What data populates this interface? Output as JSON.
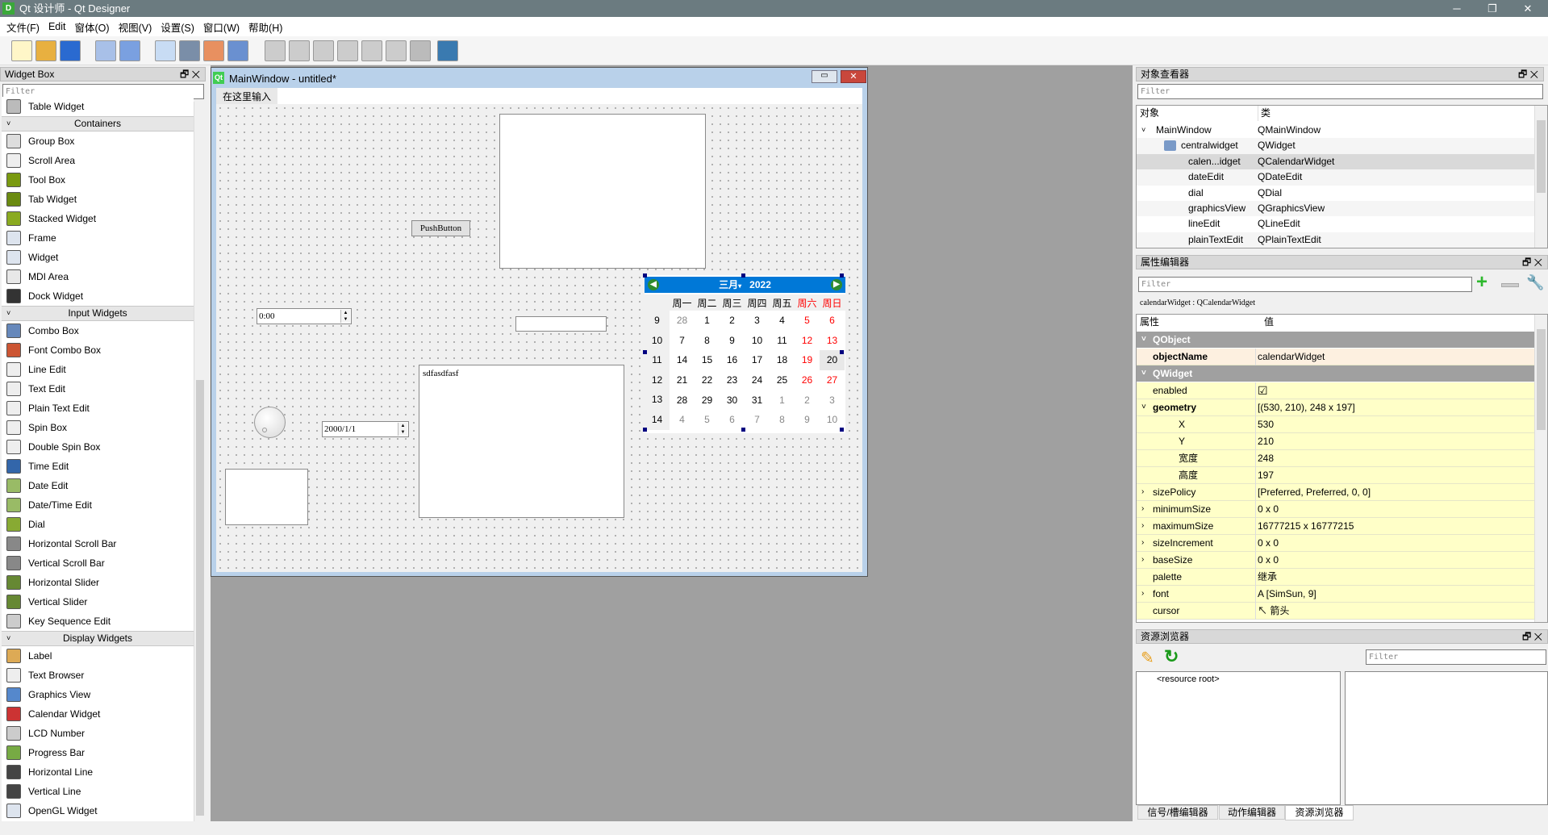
{
  "window": {
    "title": "Qt 设计师 - Qt Designer",
    "icon_letter": "D"
  },
  "menu": [
    "文件(F)",
    "Edit",
    "窗体(O)",
    "视图(V)",
    "设置(S)",
    "窗口(W)",
    "帮助(H)"
  ],
  "toolbar": [
    "new-icon",
    "open-icon",
    "save-icon",
    "send-to-back-icon",
    "bring-to-front-icon",
    "edit-widgets-icon",
    "edit-signals-slots-icon",
    "edit-buddies-icon",
    "edit-tab-order-icon",
    "layout-horizontal-icon",
    "layout-vertical-icon",
    "layout-horizontal-splitter-icon",
    "layout-vertical-splitter-icon",
    "layout-grid-icon",
    "layout-form-icon",
    "break-layout-icon",
    "adjust-size-icon"
  ],
  "widget_box": {
    "title": "Widget Box",
    "filter_placeholder": "Filter",
    "items": [
      {
        "type": "item",
        "label": "Table Widget",
        "color": "#bbbbbb"
      },
      {
        "type": "head",
        "label": "Containers"
      },
      {
        "type": "item",
        "label": "Group Box",
        "color": "#dddddd"
      },
      {
        "type": "item",
        "label": "Scroll Area",
        "color": "#eeeeee"
      },
      {
        "type": "item",
        "label": "Tool Box",
        "color": "#7a9a10"
      },
      {
        "type": "item",
        "label": "Tab Widget",
        "color": "#6a8a10"
      },
      {
        "type": "item",
        "label": "Stacked Widget",
        "color": "#8aaa20"
      },
      {
        "type": "item",
        "label": "Frame",
        "color": "#dde4ee"
      },
      {
        "type": "item",
        "label": "Widget",
        "color": "#dde4ee"
      },
      {
        "type": "item",
        "label": "MDI Area",
        "color": "#e8e8e8"
      },
      {
        "type": "item",
        "label": "Dock Widget",
        "color": "#333333"
      },
      {
        "type": "head",
        "label": "Input Widgets"
      },
      {
        "type": "item",
        "label": "Combo Box",
        "color": "#6688bb"
      },
      {
        "type": "item",
        "label": "Font Combo Box",
        "color": "#cc5533"
      },
      {
        "type": "item",
        "label": "Line Edit",
        "color": "#eeeeee"
      },
      {
        "type": "item",
        "label": "Text Edit",
        "color": "#eeeeee"
      },
      {
        "type": "item",
        "label": "Plain Text Edit",
        "color": "#eeeeee"
      },
      {
        "type": "item",
        "label": "Spin Box",
        "color": "#eeeeee"
      },
      {
        "type": "item",
        "label": "Double Spin Box",
        "color": "#eeeeee"
      },
      {
        "type": "item",
        "label": "Time Edit",
        "color": "#3366aa"
      },
      {
        "type": "item",
        "label": "Date Edit",
        "color": "#99bb66"
      },
      {
        "type": "item",
        "label": "Date/Time Edit",
        "color": "#99bb66"
      },
      {
        "type": "item",
        "label": "Dial",
        "color": "#88aa33"
      },
      {
        "type": "item",
        "label": "Horizontal Scroll Bar",
        "color": "#888888"
      },
      {
        "type": "item",
        "label": "Vertical Scroll Bar",
        "color": "#888888"
      },
      {
        "type": "item",
        "label": "Horizontal Slider",
        "color": "#668833"
      },
      {
        "type": "item",
        "label": "Vertical Slider",
        "color": "#668833"
      },
      {
        "type": "item",
        "label": "Key Sequence Edit",
        "color": "#cccccc"
      },
      {
        "type": "head",
        "label": "Display Widgets"
      },
      {
        "type": "item",
        "label": "Label",
        "color": "#ddaa55"
      },
      {
        "type": "item",
        "label": "Text Browser",
        "color": "#eeeeee"
      },
      {
        "type": "item",
        "label": "Graphics View",
        "color": "#5588cc"
      },
      {
        "type": "item",
        "label": "Calendar Widget",
        "color": "#cc3333"
      },
      {
        "type": "item",
        "label": "LCD Number",
        "color": "#cccccc"
      },
      {
        "type": "item",
        "label": "Progress Bar",
        "color": "#77aa44"
      },
      {
        "type": "item",
        "label": "Horizontal Line",
        "color": "#444444"
      },
      {
        "type": "item",
        "label": "Vertical Line",
        "color": "#444444"
      },
      {
        "type": "item",
        "label": "OpenGL Widget",
        "color": "#dde4ee"
      }
    ]
  },
  "form": {
    "title": "MainWindow - untitled*",
    "menu_placeholder": "在这里输入",
    "push_button": "PushButton",
    "time_edit": "0:00",
    "date_edit": "2000/1/1",
    "plain_text": "sdfasdfasf",
    "calendar": {
      "month": "三月",
      "year": "2022",
      "selected_day": "20",
      "day_names": [
        "周一",
        "周二",
        "周三",
        "周四",
        "周五",
        "周六",
        "周日"
      ],
      "weeks": [
        {
          "wk": "9",
          "days": [
            "28",
            "1",
            "2",
            "3",
            "4",
            "5",
            "6"
          ],
          "other": [
            true,
            false,
            false,
            false,
            false,
            false,
            false
          ]
        },
        {
          "wk": "10",
          "days": [
            "7",
            "8",
            "9",
            "10",
            "11",
            "12",
            "13"
          ],
          "other": [
            false,
            false,
            false,
            false,
            false,
            false,
            false
          ]
        },
        {
          "wk": "11",
          "days": [
            "14",
            "15",
            "16",
            "17",
            "18",
            "19",
            "20"
          ],
          "other": [
            false,
            false,
            false,
            false,
            false,
            false,
            false
          ]
        },
        {
          "wk": "12",
          "days": [
            "21",
            "22",
            "23",
            "24",
            "25",
            "26",
            "27"
          ],
          "other": [
            false,
            false,
            false,
            false,
            false,
            false,
            false
          ]
        },
        {
          "wk": "13",
          "days": [
            "28",
            "29",
            "30",
            "31",
            "1",
            "2",
            "3"
          ],
          "other": [
            false,
            false,
            false,
            false,
            true,
            true,
            true
          ]
        },
        {
          "wk": "14",
          "days": [
            "4",
            "5",
            "6",
            "7",
            "8",
            "9",
            "10"
          ],
          "other": [
            true,
            true,
            true,
            true,
            true,
            true,
            true
          ]
        }
      ],
      "weekend_color": "#ff0000",
      "header_color": "#0078d7"
    }
  },
  "object_inspector": {
    "title": "对象查看器",
    "filter_placeholder": "Filter",
    "col_object": "对象",
    "col_class": "类",
    "rows": [
      {
        "name": "MainWindow",
        "cls": "QMainWindow",
        "level": 0
      },
      {
        "name": "centralwidget",
        "cls": "QWidget",
        "level": 1
      },
      {
        "name": "calen...idget",
        "cls": "QCalendarWidget",
        "level": 2,
        "selected": true
      },
      {
        "name": "dateEdit",
        "cls": "QDateEdit",
        "level": 2
      },
      {
        "name": "dial",
        "cls": "QDial",
        "level": 2
      },
      {
        "name": "graphicsView",
        "cls": "QGraphicsView",
        "level": 2
      },
      {
        "name": "lineEdit",
        "cls": "QLineEdit",
        "level": 2
      },
      {
        "name": "plainTextEdit",
        "cls": "QPlainTextEdit",
        "level": 2
      }
    ]
  },
  "property_editor": {
    "title": "属性编辑器",
    "filter_placeholder": "Filter",
    "class_label": "calendarWidget : QCalendarWidget",
    "col_property": "属性",
    "col_value": "值",
    "rows": [
      {
        "k": "QObject",
        "v": "",
        "grp": true
      },
      {
        "k": "objectName",
        "v": "calendarWidget",
        "bold": true,
        "bg": "#fdf0e0"
      },
      {
        "k": "QWidget",
        "v": "",
        "grp": true
      },
      {
        "k": "enabled",
        "v": "☑"
      },
      {
        "k": "geometry",
        "v": "[(530, 210), 248 x 197]",
        "bold": true,
        "exp": "v"
      },
      {
        "k": "X",
        "v": "530",
        "sub": true
      },
      {
        "k": "Y",
        "v": "210",
        "sub": true
      },
      {
        "k": "宽度",
        "v": "248",
        "sub": true
      },
      {
        "k": "高度",
        "v": "197",
        "sub": true
      },
      {
        "k": "sizePolicy",
        "v": "[Preferred, Preferred, 0, 0]",
        "exp": ">"
      },
      {
        "k": "minimumSize",
        "v": "0 x 0",
        "exp": ">"
      },
      {
        "k": "maximumSize",
        "v": "16777215 x 16777215",
        "exp": ">"
      },
      {
        "k": "sizeIncrement",
        "v": "0 x 0",
        "exp": ">"
      },
      {
        "k": "baseSize",
        "v": "0 x 0",
        "exp": ">"
      },
      {
        "k": "palette",
        "v": "继承"
      },
      {
        "k": "font",
        "v": "A  [SimSun, 9]",
        "exp": ">"
      },
      {
        "k": "cursor",
        "v": "↖  箭头"
      }
    ]
  },
  "resource_browser": {
    "title": "资源浏览器",
    "filter_placeholder": "Filter",
    "root": "<resource root>"
  },
  "bottom_tabs": [
    "信号/槽编辑器",
    "动作编辑器",
    "资源浏览器"
  ]
}
